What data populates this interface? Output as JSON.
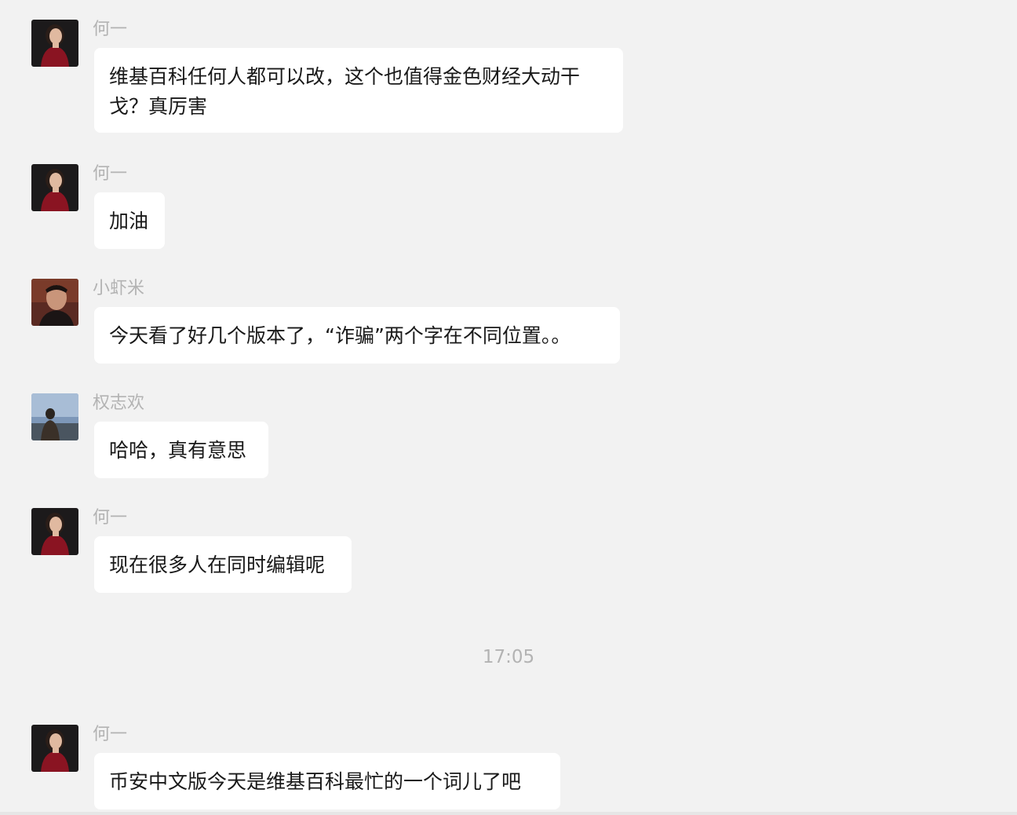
{
  "messages": [
    {
      "sender": "何一",
      "avatar": "avatar-woman-red-dress",
      "text": "维基百科任何人都可以改，这个也值得金色财经大动干戈？真厉害"
    },
    {
      "sender": "何一",
      "avatar": "avatar-woman-red-dress",
      "text": "加油"
    },
    {
      "sender": "小虾米",
      "avatar": "avatar-man-portrait",
      "text": "今天看了好几个版本了，“诈骗”两个字在不同位置。。"
    },
    {
      "sender": "权志欢",
      "avatar": "avatar-landscape-person",
      "text": "哈哈，真有意思"
    },
    {
      "sender": "何一",
      "avatar": "avatar-woman-red-dress",
      "text": "现在很多人在同时编辑呢"
    },
    {
      "sender": "何一",
      "avatar": "avatar-woman-red-dress",
      "text": "币安中文版今天是维基百科最忙的一个词儿了吧"
    }
  ],
  "timestamp": "17:05",
  "colors": {
    "background": "#f2f2f2",
    "bubble": "#ffffff",
    "sender_text": "#b3b3b3",
    "message_text": "#191919"
  }
}
